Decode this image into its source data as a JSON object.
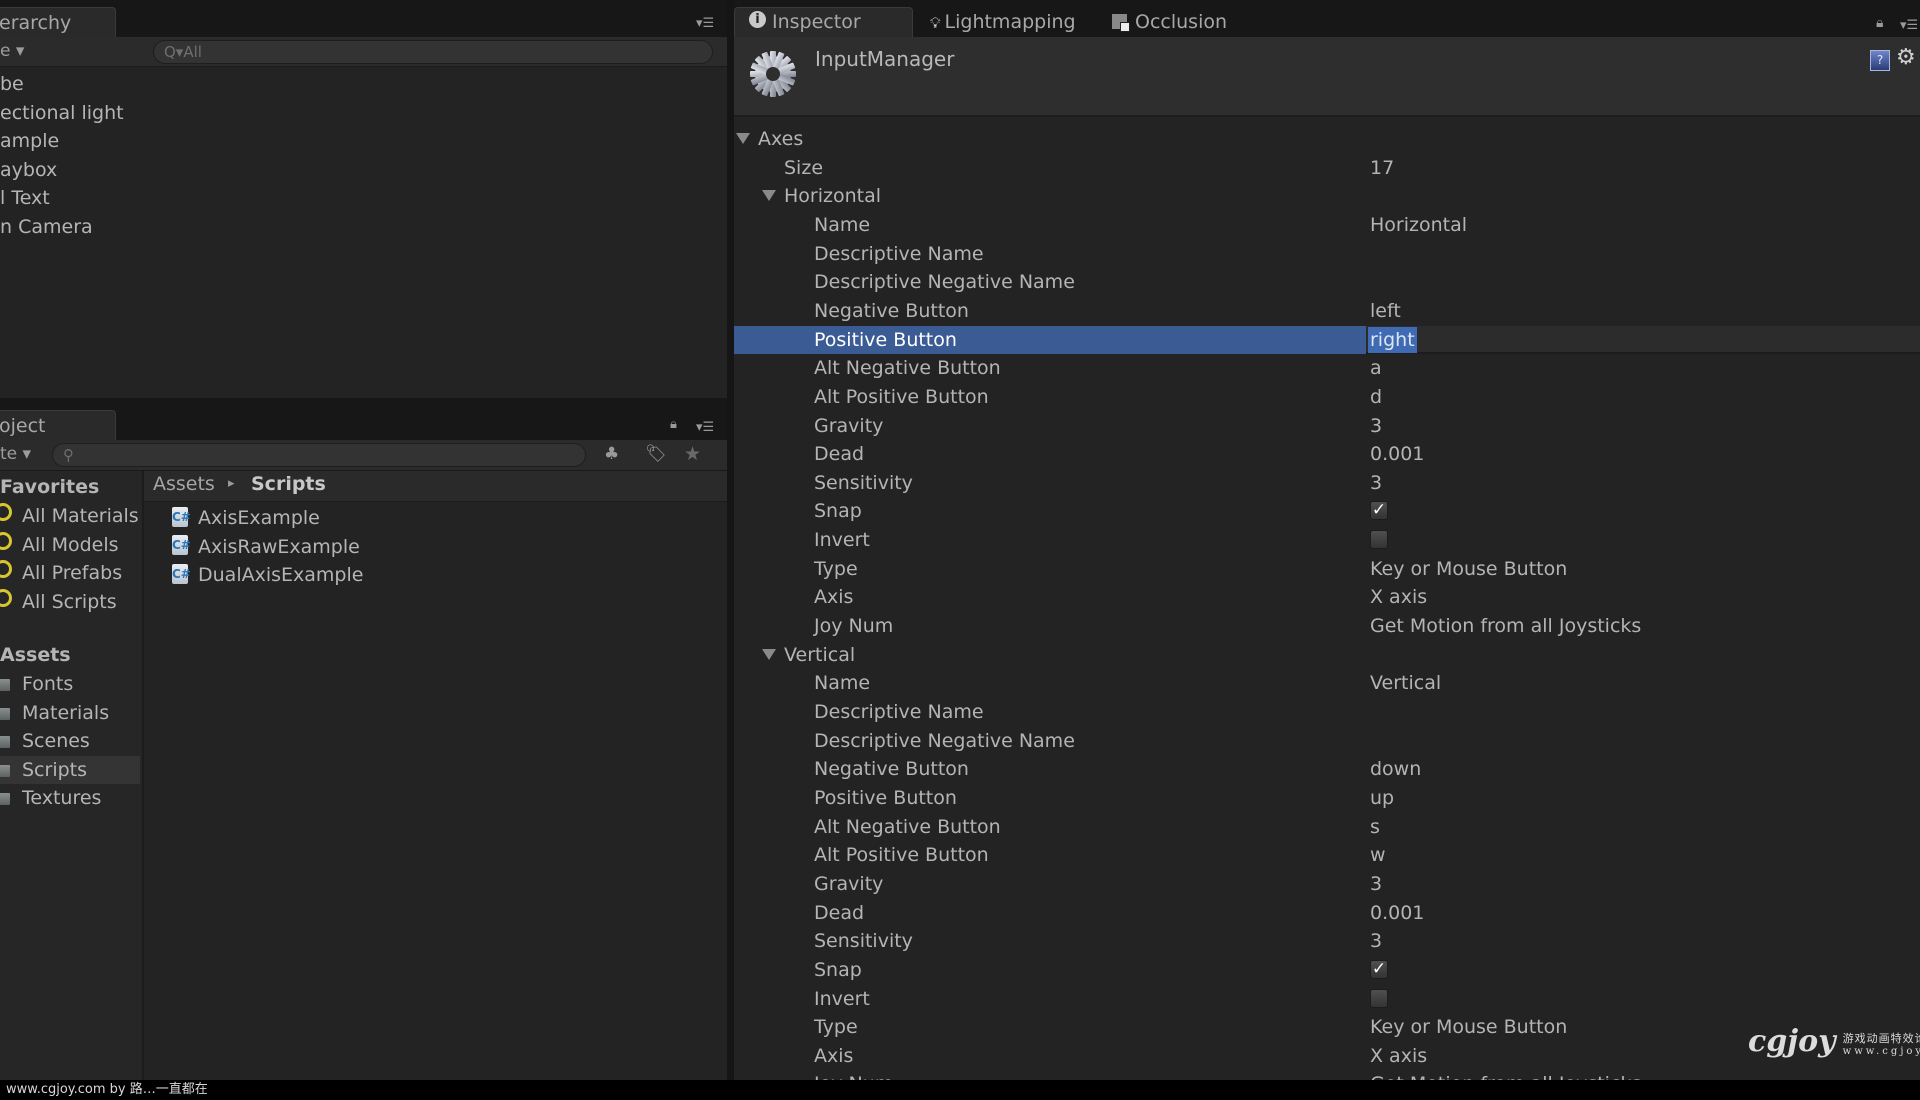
{
  "hierarchy": {
    "tab_label": "erarchy",
    "create_dropdown": "e ▾",
    "search_placeholder": "Q▾All",
    "items": [
      "be",
      "ectional light",
      "ample",
      "aybox",
      "l Text",
      "n Camera"
    ]
  },
  "project": {
    "tab_label": "oject",
    "create_dropdown": "te ▾",
    "search_placeholder": "",
    "favorites_header": "Favorites",
    "favorites": [
      "All Materials",
      "All Models",
      "All Prefabs",
      "All Scripts"
    ],
    "assets_header": "Assets",
    "folders": [
      "Fonts",
      "Materials",
      "Scenes",
      "Scripts",
      "Textures"
    ],
    "selected_folder": "Scripts",
    "breadcrumb": {
      "root": "Assets",
      "separator": "▸",
      "current": "Scripts"
    },
    "files": [
      "AxisExample",
      "AxisRawExample",
      "DualAxisExample"
    ],
    "file_icon": "C#"
  },
  "inspector": {
    "tabs": [
      {
        "label": "Inspector",
        "icon": "info-icon",
        "active": true
      },
      {
        "label": "Lightmapping",
        "icon": "lightbulb-icon",
        "active": false
      },
      {
        "label": "Occlusion",
        "icon": "occlusion-icon",
        "active": false
      }
    ],
    "object_name": "InputManager",
    "help_icon_glyph": "?",
    "rows": [
      {
        "indent": 0,
        "label": "Axes",
        "foldout": true
      },
      {
        "indent": 1,
        "label": "Size",
        "value": "17"
      },
      {
        "indent": 1,
        "label": "Horizontal",
        "foldout": true
      },
      {
        "indent": 2,
        "label": "Name",
        "value": "Horizontal"
      },
      {
        "indent": 2,
        "label": "Descriptive Name",
        "value": ""
      },
      {
        "indent": 2,
        "label": "Descriptive Negative Name",
        "value": ""
      },
      {
        "indent": 2,
        "label": "Negative Button",
        "value": "left"
      },
      {
        "indent": 2,
        "label": "Positive Button",
        "value": "right",
        "selected": true
      },
      {
        "indent": 2,
        "label": "Alt Negative Button",
        "value": "a"
      },
      {
        "indent": 2,
        "label": "Alt Positive Button",
        "value": "d"
      },
      {
        "indent": 2,
        "label": "Gravity",
        "value": "3"
      },
      {
        "indent": 2,
        "label": "Dead",
        "value": "0.001"
      },
      {
        "indent": 2,
        "label": "Sensitivity",
        "value": "3"
      },
      {
        "indent": 2,
        "label": "Snap",
        "checkbox": true,
        "checked": true
      },
      {
        "indent": 2,
        "label": "Invert",
        "checkbox": true,
        "checked": false
      },
      {
        "indent": 2,
        "label": "Type",
        "value": "Key or Mouse Button"
      },
      {
        "indent": 2,
        "label": "Axis",
        "value": "X axis"
      },
      {
        "indent": 2,
        "label": "Joy Num",
        "value": "Get Motion from all Joysticks"
      },
      {
        "indent": 1,
        "label": "Vertical",
        "foldout": true
      },
      {
        "indent": 2,
        "label": "Name",
        "value": "Vertical"
      },
      {
        "indent": 2,
        "label": "Descriptive Name",
        "value": ""
      },
      {
        "indent": 2,
        "label": "Descriptive Negative Name",
        "value": ""
      },
      {
        "indent": 2,
        "label": "Negative Button",
        "value": "down"
      },
      {
        "indent": 2,
        "label": "Positive Button",
        "value": "up"
      },
      {
        "indent": 2,
        "label": "Alt Negative Button",
        "value": "s"
      },
      {
        "indent": 2,
        "label": "Alt Positive Button",
        "value": "w"
      },
      {
        "indent": 2,
        "label": "Gravity",
        "value": "3"
      },
      {
        "indent": 2,
        "label": "Dead",
        "value": "0.001"
      },
      {
        "indent": 2,
        "label": "Sensitivity",
        "value": "3"
      },
      {
        "indent": 2,
        "label": "Snap",
        "checkbox": true,
        "checked": true
      },
      {
        "indent": 2,
        "label": "Invert",
        "checkbox": true,
        "checked": false
      },
      {
        "indent": 2,
        "label": "Type",
        "value": "Key or Mouse Button"
      },
      {
        "indent": 2,
        "label": "Axis",
        "value": "X axis"
      },
      {
        "indent": 2,
        "label": "Joy Num",
        "value": "Get Motion from all Joysticks"
      }
    ]
  },
  "watermark": {
    "text": "www.cgjoy.com by 路…一直都在",
    "logo": "cgjoy",
    "logo_sub_cn": "游戏动画特效论坛",
    "logo_sub_url": "www.cgjoy.com"
  },
  "colors": {
    "selection": "#3a5b94",
    "text_selection": "#3e6bb4",
    "panel_bg": "#232323",
    "favorites_icon": "#d8c630"
  }
}
